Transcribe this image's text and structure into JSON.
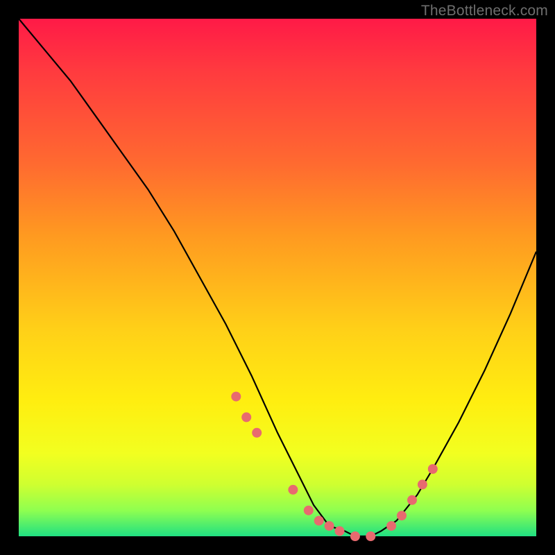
{
  "watermark": "TheBottleneck.com",
  "colors": {
    "frame_bg": "#000000",
    "gradient_top": "#ff1a47",
    "gradient_bottom": "#20e082",
    "curve_stroke": "#000000",
    "dot_fill": "#e86a6f"
  },
  "chart_data": {
    "type": "line",
    "title": "",
    "xlabel": "",
    "ylabel": "",
    "xlim": [
      0,
      100
    ],
    "ylim": [
      0,
      100
    ],
    "grid": false,
    "legend": false,
    "series": [
      {
        "name": "bottleneck-curve",
        "x": [
          0,
          5,
          10,
          15,
          20,
          25,
          30,
          35,
          40,
          45,
          50,
          55,
          57,
          60,
          63,
          65,
          68,
          70,
          73,
          77,
          80,
          85,
          90,
          95,
          100
        ],
        "values": [
          100,
          94,
          88,
          81,
          74,
          67,
          59,
          50,
          41,
          31,
          20,
          10,
          6,
          2,
          1,
          0,
          0,
          1,
          3,
          8,
          13,
          22,
          32,
          43,
          55
        ]
      }
    ],
    "markers": {
      "name": "highlight-dots",
      "x": [
        42,
        44,
        46,
        53,
        56,
        58,
        60,
        62,
        65,
        68,
        72,
        74,
        76,
        78,
        80
      ],
      "values": [
        27,
        23,
        20,
        9,
        5,
        3,
        2,
        1,
        0,
        0,
        2,
        4,
        7,
        10,
        13
      ]
    }
  }
}
